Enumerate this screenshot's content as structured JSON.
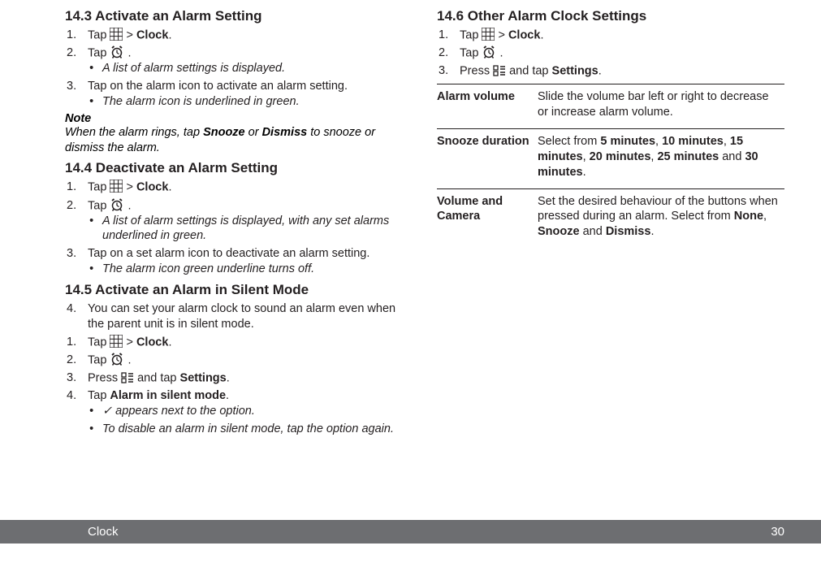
{
  "s143": {
    "heading": "14.3   Activate an Alarm Setting",
    "step1_a": "Tap ",
    "step1_b": " > ",
    "step1_clock": "Clock",
    "step1_c": ".",
    "step2_a": "Tap  ",
    "step2_b": " .",
    "bullet1": "A list of alarm settings is displayed.",
    "step3": "Tap on the alarm icon to activate an alarm setting.",
    "bullet2": "The alarm icon is underlined in green.",
    "note_head": "Note",
    "note_a": "When the alarm rings, tap ",
    "note_snooze": "Snooze",
    "note_or": " or ",
    "note_dismiss": "Dismiss",
    "note_b": " to snooze or dismiss the alarm."
  },
  "s144": {
    "heading": "14.4   Deactivate an Alarm Setting",
    "step1_a": "Tap ",
    "step1_b": " > ",
    "step1_clock": "Clock",
    "step1_c": ".",
    "step2_a": "Tap  ",
    "step2_b": " .",
    "bullet1": "A list of alarm settings is displayed, with any set alarms underlined in green.",
    "step3": "Tap on a set alarm icon to deactivate an alarm setting.",
    "bullet2": "The alarm icon green underline turns off."
  },
  "s145": {
    "heading": "14.5   Activate an Alarm in Silent Mode",
    "step4": "You can set your alarm clock to sound an alarm even when the parent unit is in silent mode.",
    "step1_a": "Tap ",
    "step1_b": " > ",
    "step1_clock": "Clock",
    "step1_c": ".",
    "step2_a": "Tap  ",
    "step2_b": " .",
    "step3_a": "Press ",
    "step3_b": " and tap ",
    "step3_settings": "Settings",
    "step3_c": ".",
    "step4b_a": "Tap ",
    "step4b_bold": "Alarm in silent mode",
    "step4b_b": ".",
    "bullet1_a": "✓",
    "bullet1_b": " appears next to the option.",
    "bullet2": "To disable an alarm in silent mode, tap the option again."
  },
  "s146": {
    "heading": "14.6   Other Alarm Clock Settings",
    "step1_a": "Tap ",
    "step1_b": " > ",
    "step1_clock": "Clock",
    "step1_c": ".",
    "step2_a": "Tap  ",
    "step2_b": " .",
    "step3_a": "Press ",
    "step3_b": " and tap ",
    "step3_settings": "Settings",
    "step3_c": ".",
    "row1_label": "Alarm volume",
    "row1_desc": "Slide the volume bar left or right to decrease or increase alarm volume.",
    "row2_label": "Snooze duration",
    "row2_a": "Select from ",
    "row2_5": "5 minutes",
    "row2_c1": ", ",
    "row2_10": "10 minutes",
    "row2_c2": ", ",
    "row2_15": "15 minutes",
    "row2_c3": ", ",
    "row2_20": "20 minutes",
    "row2_c4": ", ",
    "row2_25": "25 minutes",
    "row2_and": " and ",
    "row2_30": "30 minutes",
    "row2_d": ".",
    "row3_label": "Volume and Camera",
    "row3_a": "Set the desired behaviour of the buttons when pressed during an alarm. Select from ",
    "row3_none": "None",
    "row3_c1": ", ",
    "row3_snooze": "Snooze",
    "row3_and": " and ",
    "row3_dismiss": "Dismiss",
    "row3_d": "."
  },
  "footer": {
    "title": "Clock",
    "page": "30"
  }
}
